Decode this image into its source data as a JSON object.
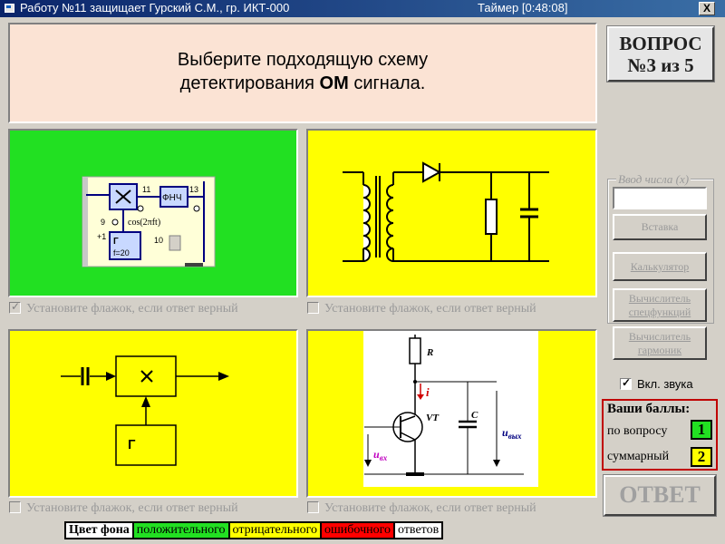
{
  "window": {
    "title": "Работу №11 защищает Гурский С.М., гр. ИКТ-000",
    "timer": "Таймер [0:48:08]",
    "close_label": "X"
  },
  "question": {
    "line1": "Выберите подходящую схему",
    "line2_pre": "детектирования ",
    "line2_bold": "ОМ",
    "line2_post": " сигнала."
  },
  "question_number": {
    "line1": "ВОПРОС",
    "line2": "№3 из 5"
  },
  "options": [
    {
      "checkbox_label": "Установите флажок, если ответ верный",
      "checked": true,
      "background": "#22e022"
    },
    {
      "checkbox_label": "Установите флажок, если ответ верный",
      "checked": false,
      "background": "#ffff00"
    },
    {
      "checkbox_label": "Установите флажок, если ответ верный",
      "checked": false,
      "background": "#ffff00"
    },
    {
      "checkbox_label": "Установите флажок, если ответ верный",
      "checked": false,
      "background": "#ffff00"
    }
  ],
  "diagram1": {
    "fnch": "ФНЧ",
    "n11": "11",
    "n13": "13",
    "n9": "9",
    "cos": "cos(2πft)",
    "plus1": "+1",
    "gen": "Г",
    "freq": "f=20",
    "n10": "10"
  },
  "diagram3": {
    "gen": "Г"
  },
  "diagram4": {
    "r": "R",
    "i": "i",
    "vt": "VT",
    "c": "C",
    "u_in": "u",
    "u_in_sub": "вх",
    "u_out": "u",
    "u_out_sub": "вых"
  },
  "number_input": {
    "legend": "Ввод числа (x)",
    "value": ""
  },
  "buttons": {
    "insert": "Вставка",
    "calculator": "Калькулятор",
    "special_l1": "Вычислитель",
    "special_l2": "спецфункций",
    "harmonic_l1": "Вычислитель",
    "harmonic_l2": "гармоник",
    "answer": "ОТВЕТ"
  },
  "sound": {
    "label": "Вкл. звука",
    "checked": true
  },
  "scores": {
    "title": "Ваши баллы:",
    "per_question_label": "по вопросу",
    "per_question_value": "1",
    "total_label": "суммарный",
    "total_value": "2"
  },
  "legend": {
    "title": "Цвет фона",
    "positive": "положительного",
    "negative": "отрицательного",
    "wrong": "ошибочного",
    "answers": "ответов"
  },
  "colors": {
    "positive": "#22e022",
    "negative": "#ffff00",
    "wrong": "#ff0000"
  }
}
